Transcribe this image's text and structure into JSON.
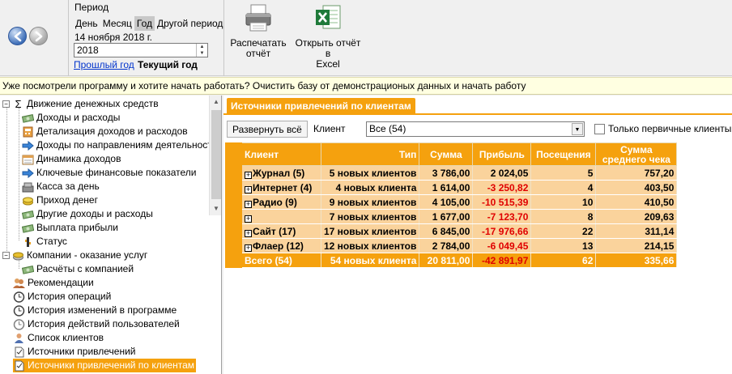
{
  "toolbar": {
    "period_label": "Период",
    "period_tabs": [
      "День",
      "Месяц",
      "Год",
      "Другой период"
    ],
    "active_tab_index": 2,
    "date_text": "14 ноября 2018 г.",
    "year_value": "2018",
    "prev_year_link": "Прошлый год",
    "current_year_label": "Текущий год",
    "print_label_line1": "Распечатать",
    "print_label_line2": "отчёт",
    "excel_label_line1": "Открыть отчёт в",
    "excel_label_line2": "Excel"
  },
  "infobar": {
    "text": "Уже посмотрели программу и хотите начать работать?  Очистить базу от демонстрационых данных и начать работу"
  },
  "tree": {
    "items": [
      {
        "label": "Движение денежных средств",
        "icon": "sigma-icon"
      },
      {
        "label": "Доходы и расходы",
        "icon": "money-icon"
      },
      {
        "label": "Детализация доходов и расходов",
        "icon": "calculator-icon"
      },
      {
        "label": "Доходы по направлениям деятельности",
        "icon": "arrow-right-icon"
      },
      {
        "label": "Динамика доходов",
        "icon": "calendar-icon"
      },
      {
        "label": "Ключевые финансовые показатели",
        "icon": "arrow-right-icon"
      },
      {
        "label": "Касса за день",
        "icon": "cash-register-icon"
      },
      {
        "label": "Приход денег",
        "icon": "coins-icon"
      },
      {
        "label": "Другие доходы и расходы",
        "icon": "money-icon"
      },
      {
        "label": "Выплата прибыли",
        "icon": "money-icon"
      },
      {
        "label": "Статус",
        "icon": "status-icon"
      },
      {
        "label": "Компании - оказание услуг",
        "icon": "coins-icon"
      },
      {
        "label": "Расчёты с компанией",
        "icon": "money-icon"
      },
      {
        "label": "Рекомендации",
        "icon": "people-icon"
      },
      {
        "label": "История операций",
        "icon": "clock-icon"
      },
      {
        "label": "История изменений в программе",
        "icon": "clock-icon"
      },
      {
        "label": "История действий пользователей",
        "icon": "clock-icon"
      },
      {
        "label": "Список клиентов",
        "icon": "person-icon"
      },
      {
        "label": "Источники привлечений",
        "icon": "document-icon"
      },
      {
        "label": "Источники привлечений по клиентам",
        "icon": "document-icon"
      }
    ]
  },
  "main": {
    "tab_label": "Источники привлечений по клиентам",
    "expand_all_label": "Развернуть всё",
    "client_label": "Клиент",
    "client_value": "Все (54)",
    "first_only_label": "Только первичные клиенты",
    "columns": [
      "Клиент",
      "Тип",
      "Сумма",
      "Прибыль",
      "Посещения",
      "Сумма среднего чека"
    ],
    "rows": [
      {
        "client": "Журнал (5)",
        "type": "5 новых клиентов",
        "sum": "3 786,00",
        "profit": "2 024,05",
        "visits": "5",
        "avg": "757,20",
        "neg": false
      },
      {
        "client": "Интернет (4)",
        "type": "4 новых клиента",
        "sum": "1 614,00",
        "profit": "-3 250,82",
        "visits": "4",
        "avg": "403,50",
        "neg": true
      },
      {
        "client": "Радио (9)",
        "type": "9 новых клиентов",
        "sum": "4 105,00",
        "profit": "-10 515,39",
        "visits": "10",
        "avg": "410,50",
        "neg": true
      },
      {
        "client": "",
        "type": "7 новых клиентов",
        "sum": "1 677,00",
        "profit": "-7 123,70",
        "visits": "8",
        "avg": "209,63",
        "neg": true
      },
      {
        "client": "Сайт (17)",
        "type": "17 новых клиентов",
        "sum": "6 845,00",
        "profit": "-17 976,66",
        "visits": "22",
        "avg": "311,14",
        "neg": true
      },
      {
        "client": "Флаер (12)",
        "type": "12 новых клиентов",
        "sum": "2 784,00",
        "profit": "-6 049,45",
        "visits": "13",
        "avg": "214,15",
        "neg": true
      }
    ],
    "total": {
      "client": "Всего (54)",
      "type": "54 новых клиента",
      "sum": "20 811,00",
      "profit": "-42 891,97",
      "visits": "62",
      "avg": "335,66"
    }
  },
  "colors": {
    "accent": "#f5a10e",
    "row_bg": "#fad39c",
    "negative": "#e00000",
    "infobar_bg": "#ffffe1"
  }
}
